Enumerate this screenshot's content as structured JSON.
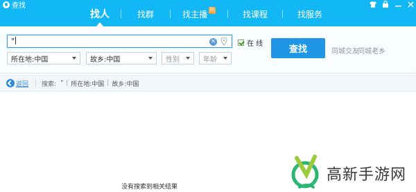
{
  "window": {
    "title": "查找",
    "controls": [
      "shirt-icon",
      "lock-icon",
      "minimize-icon",
      "close-icon"
    ]
  },
  "nav": {
    "items": [
      {
        "label": "找人",
        "active": true
      },
      {
        "label": "找群",
        "active": false
      },
      {
        "label": "找主播",
        "active": false,
        "badge": "热"
      },
      {
        "label": "找课程",
        "active": false
      },
      {
        "label": "找服务",
        "active": false
      }
    ]
  },
  "search": {
    "value": "\"",
    "online_label": "在  线",
    "online_checked": true,
    "find_label": "查找",
    "location": "所在地:中国",
    "hometown": "故乡:中国",
    "gender_placeholder": "性别",
    "age_placeholder": "年龄",
    "link_city_friends": "同城交友",
    "link_townsmen": "同城老乡"
  },
  "result_bar": {
    "back_label": "返回",
    "search_prefix": "搜索:",
    "crumbs": [
      "\"",
      "所在地:中国",
      "故乡:中国"
    ]
  },
  "empty_message": "没有搜索到相关结果",
  "watermark": {
    "text": "高新手游网"
  },
  "colors": {
    "nav_bg": "#12b7f5",
    "button": "#1f97e6",
    "hot_badge": "#ff9b2f",
    "link": "#2f87d8"
  }
}
